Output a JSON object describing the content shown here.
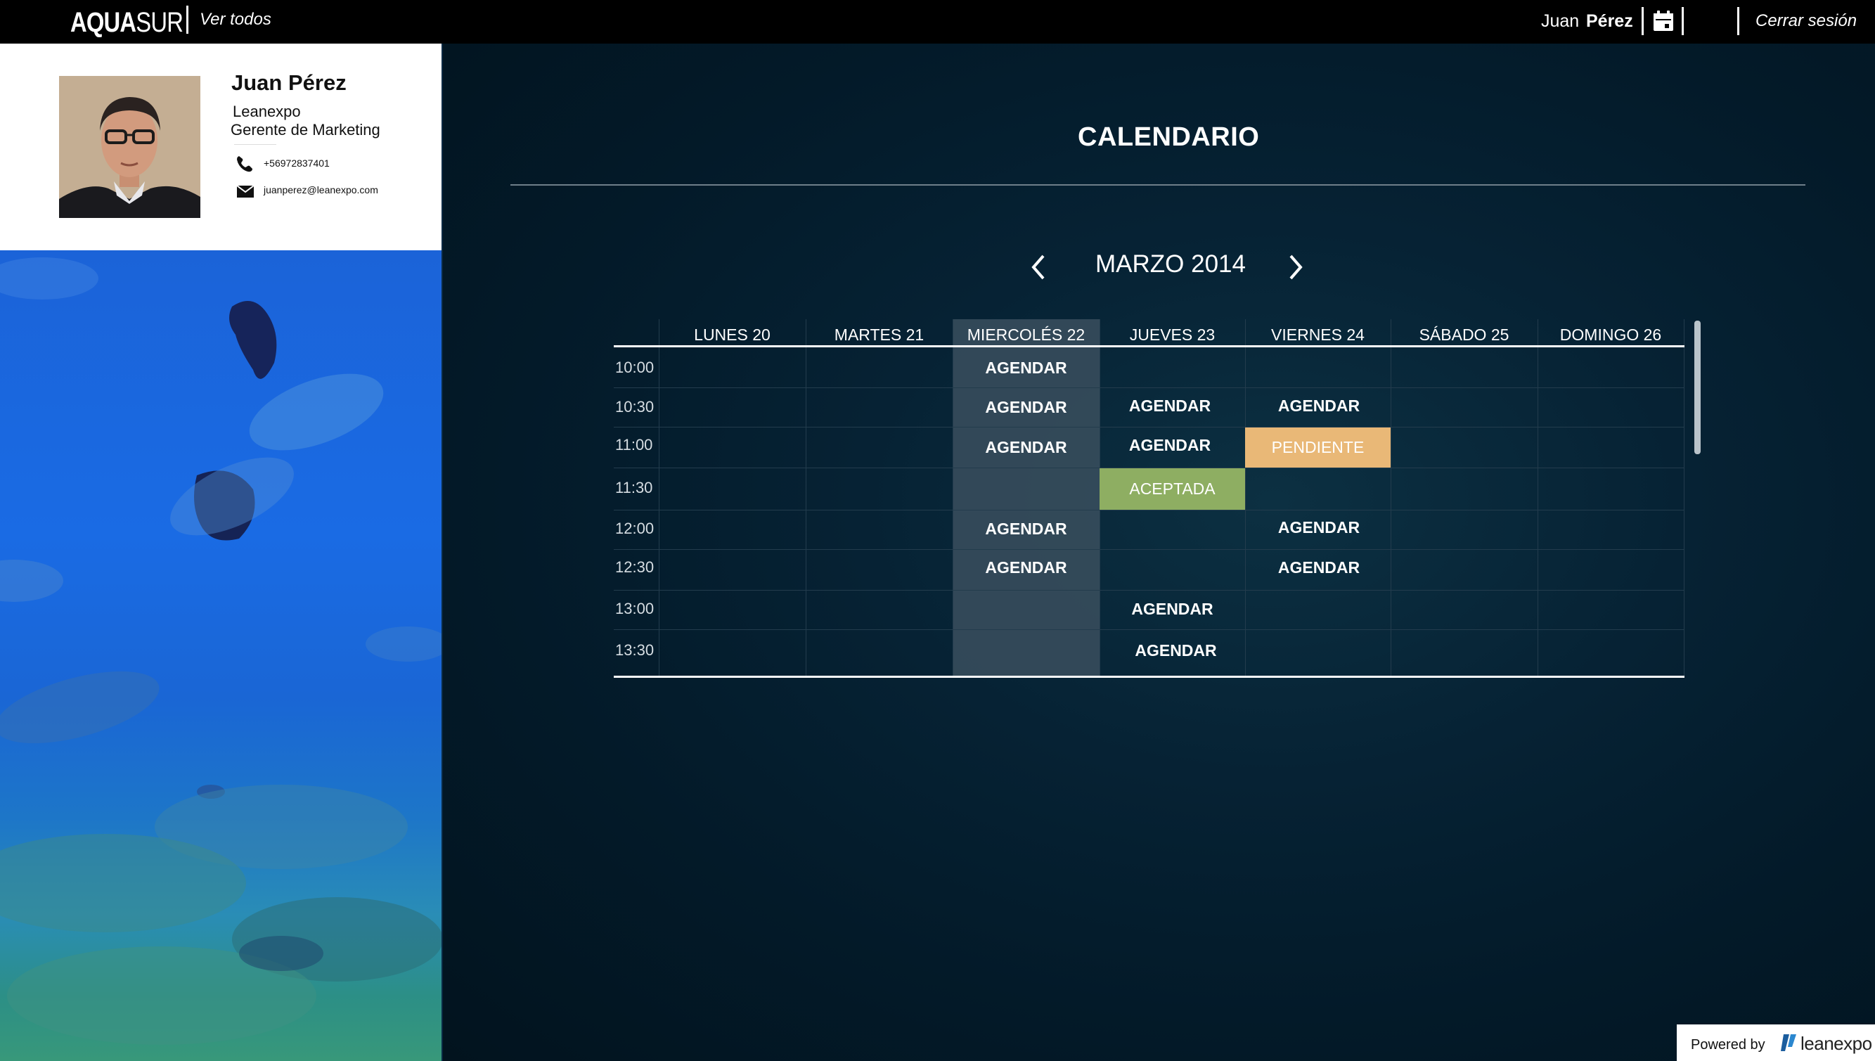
{
  "header": {
    "logo_main": "AQUA",
    "logo_tail": "SUR",
    "view_all": "Ver todos",
    "user_first_name": "Juan",
    "user_last_name": "Pérez",
    "logout": "Cerrar sesión"
  },
  "profile": {
    "name": "Juan Pérez",
    "company": "Leanexpo",
    "role": "Gerente de Marketing",
    "phone": "+56972837401",
    "email": "juanperez@leanexpo.com"
  },
  "calendar": {
    "title": "CALENDARIO",
    "month": "MARZO 2014",
    "days": [
      "LUNES 20",
      "MARTES 21",
      "MIERCOLÉS 22",
      "JUEVES 23",
      "VIERNES 24",
      "SÁBADO 25",
      "DOMINGO 26"
    ],
    "times": [
      "10:00",
      "10:30",
      "11:00",
      "11:30",
      "12:00",
      "12:30",
      "13:00",
      "13:30"
    ],
    "agendar": "AGENDAR",
    "pendiente": "PENDIENTE",
    "aceptada": "ACEPTADA"
  },
  "footer": {
    "powered_by": "Powered by",
    "brand": "leanexpo"
  },
  "colors": {
    "pending": "#e9b877",
    "accepted": "#8eae62",
    "highlight_column": "#3a4f5e"
  }
}
